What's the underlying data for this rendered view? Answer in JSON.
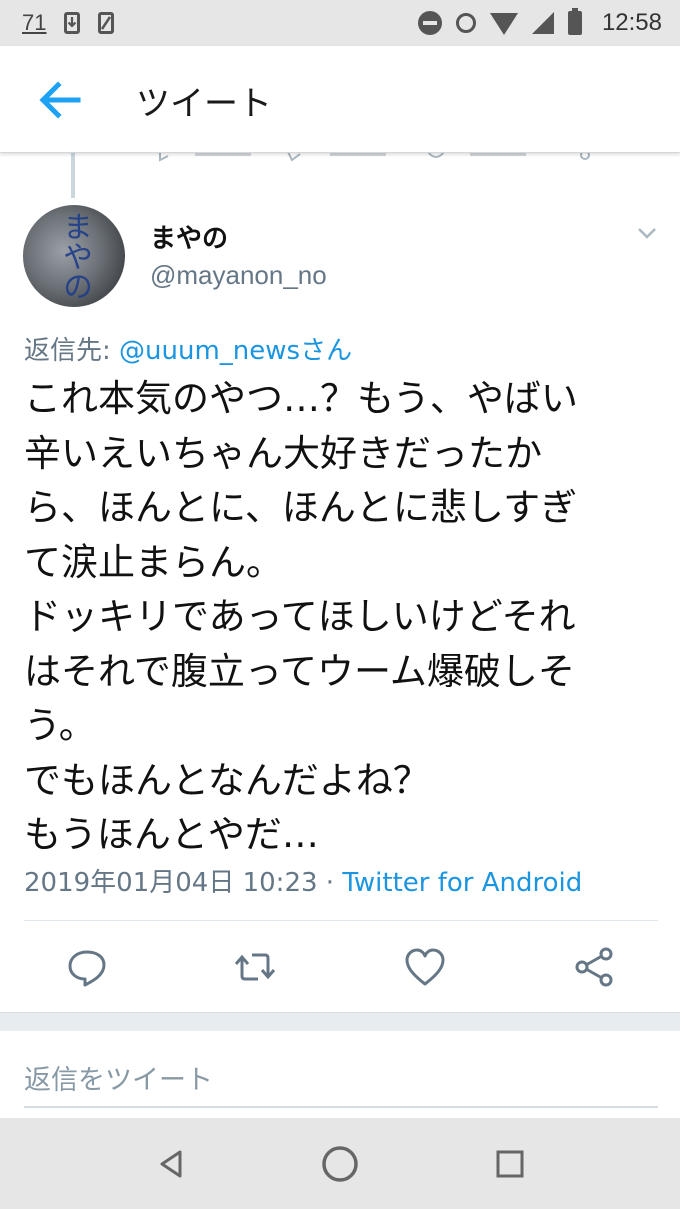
{
  "status_bar": {
    "notification_count": "71",
    "time": "12:58"
  },
  "header": {
    "title": "ツイート"
  },
  "tweet": {
    "display_name": "まやの",
    "screen_name": "@mayanon_no",
    "avatar_text": "まやの",
    "reply_prefix": "返信先: ",
    "reply_mention": "@uuum_newsさん",
    "text": "これ本気のやつ…？もう、やばい\n辛いえいちゃん大好きだったか\nら、ほんとに、ほんとに悲しすぎ\nて涙止まらん。\nドッキリであってほしいけどそれ\nはそれで腹立ってウーム爆破しそ\nう。\nでもほんとなんだよね？\nもうほんとやだ…",
    "timestamp": "2019年01月04日 10:23 · ",
    "source": "Twitter for Android"
  },
  "reply_box": {
    "placeholder": "返信をツイート"
  },
  "colors": {
    "accent": "#1b95e0",
    "secondary_text": "#657786",
    "icon_gray": "#657786"
  }
}
